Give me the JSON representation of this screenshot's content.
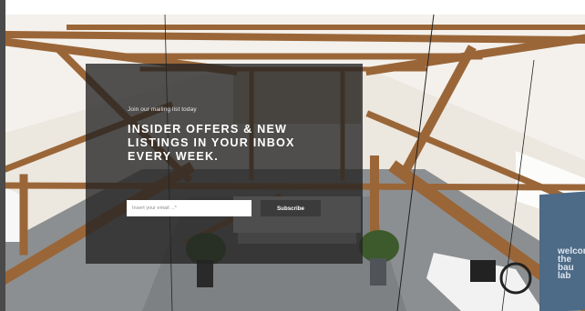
{
  "newsletter": {
    "eyebrow": "Join our mailing list today",
    "headline_lines": [
      "INSIDER OFFERS & NEW",
      "LISTINGS IN YOUR INBOX",
      "EVERY WEEK."
    ],
    "email_placeholder": "Insert your email ...*",
    "email_value": "",
    "subscribe_label": "Subscribe"
  },
  "background": {
    "sign_text": "welcom\nthe\nbau\nlab"
  },
  "colors": {
    "overlay": "#222222",
    "beam": "#9a6638",
    "button": "#3b3b3b",
    "sign": "#4d6a86"
  }
}
